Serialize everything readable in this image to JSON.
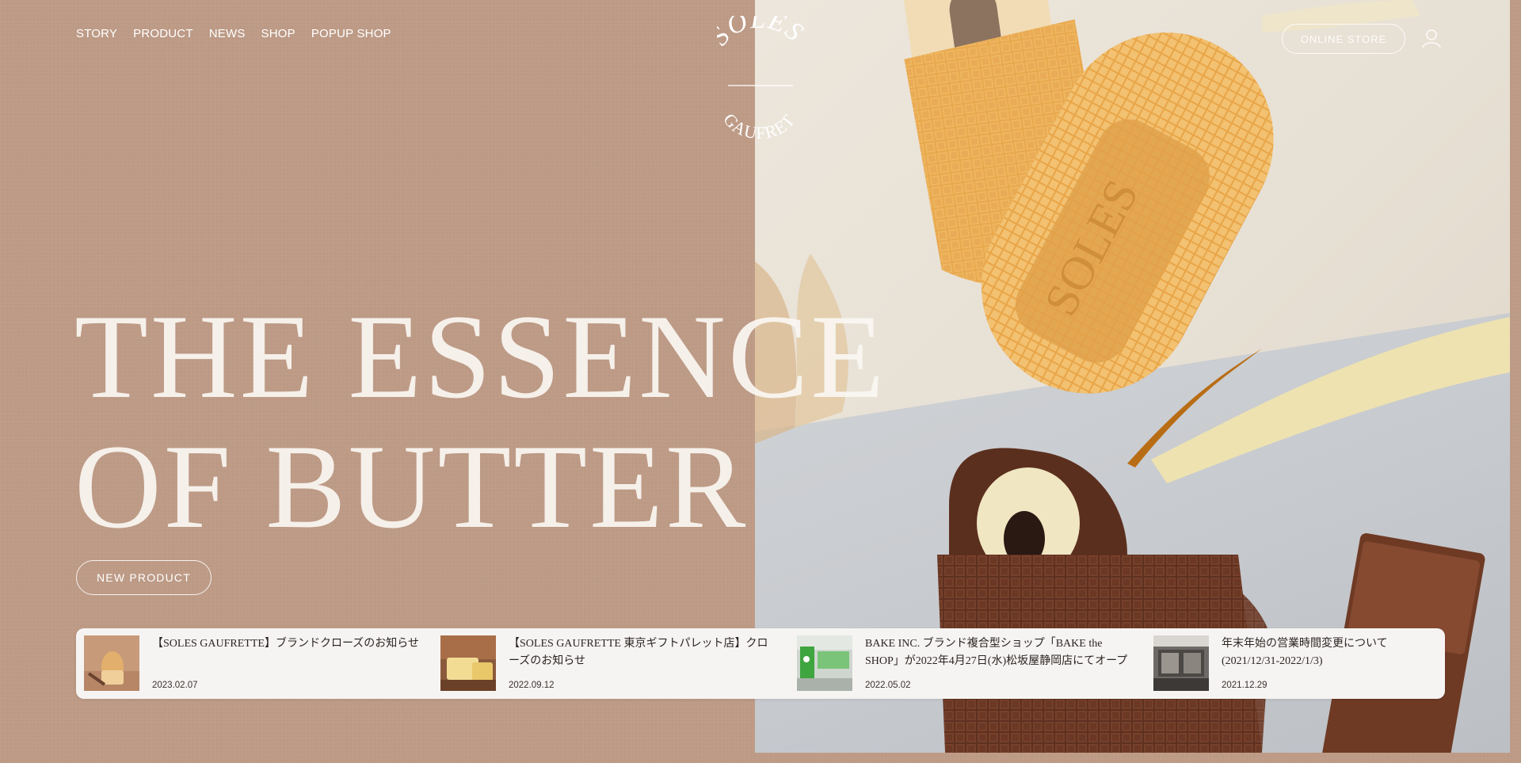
{
  "nav": {
    "items": [
      "STORY",
      "PRODUCT",
      "NEWS",
      "SHOP",
      "POPUP SHOP"
    ]
  },
  "brand": {
    "logo_top": "SOLES",
    "logo_bottom": "GAUFRETTE"
  },
  "header": {
    "online_store_label": "ONLINE STORE",
    "account_icon": "user-icon"
  },
  "hero": {
    "line1": "THE ESSENCE",
    "line2": "OF BUTTER",
    "cta_label": "NEW PRODUCT"
  },
  "news": [
    {
      "title": "【SOLES GAUFRETTE】ブランドクローズのお知らせ",
      "date": "2023.02.07",
      "thumb": "gaufrette-honey-image"
    },
    {
      "title": "【SOLES GAUFRETTE 東京ギフトパレット店】クローズのお知らせ",
      "date": "2022.09.12",
      "thumb": "butter-block-image"
    },
    {
      "title": "BAKE INC. ブランド複合型ショップ「BAKE the SHOP」が2022年4月27日(水)松坂屋静岡店にてオープン",
      "date": "2022.05.02",
      "thumb": "shop-interior-image"
    },
    {
      "title": "年末年始の営業時間変更について(2021/12/31-2022/1/3)",
      "date": "2021.12.29",
      "thumb": "storefront-image"
    }
  ],
  "colors": {
    "background": "#bd9a85",
    "news_bar": "#f6f4f3",
    "text_dark": "#2b2422"
  }
}
